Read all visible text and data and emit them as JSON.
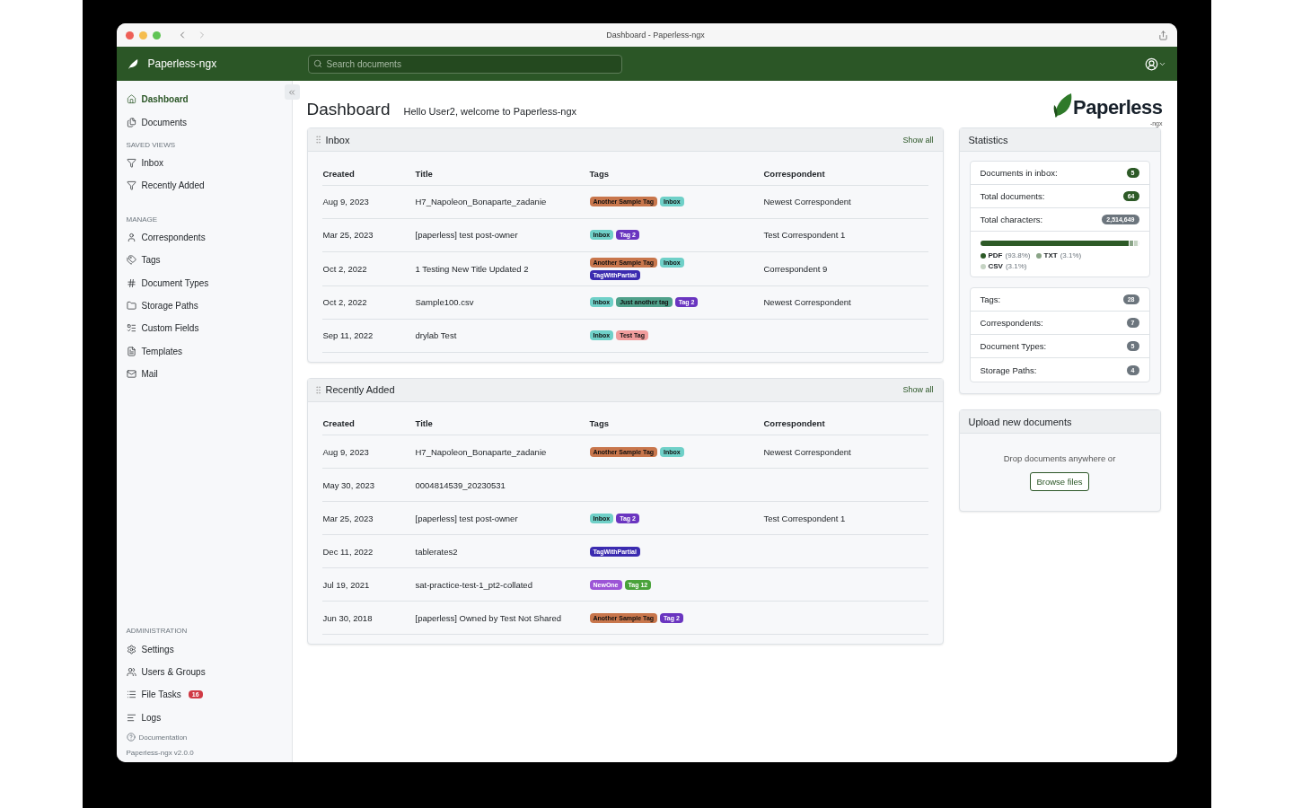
{
  "window": {
    "title": "Dashboard - Paperless-ngx"
  },
  "navbar": {
    "brand": "Paperless-ngx",
    "search": {
      "placeholder": "Search documents"
    }
  },
  "sidebar": {
    "items": [
      {
        "label": "Dashboard",
        "selected": true
      },
      {
        "label": "Documents",
        "selected": false
      }
    ],
    "sections": [
      {
        "heading": "SAVED VIEWS",
        "items": [
          {
            "label": "Inbox",
            "selected": false
          },
          {
            "label": "Recently Added",
            "selected": false
          }
        ]
      },
      {
        "heading": "MANAGE",
        "items": [
          {
            "label": "Correspondents",
            "selected": false
          },
          {
            "label": "Tags",
            "selected": false
          },
          {
            "label": "Document Types",
            "selected": false
          },
          {
            "label": "Storage Paths",
            "selected": false
          },
          {
            "label": "Custom Fields",
            "selected": false
          },
          {
            "label": "Templates",
            "selected": false
          },
          {
            "label": "Mail",
            "selected": false
          }
        ]
      },
      {
        "heading": "ADMINISTRATION",
        "items": [
          {
            "label": "Settings",
            "selected": false
          },
          {
            "label": "Users & Groups",
            "selected": false
          },
          {
            "label": "File Tasks",
            "selected": false,
            "badge": "16"
          },
          {
            "label": "Logs",
            "selected": false
          }
        ]
      }
    ],
    "documentation": "Documentation",
    "version": "Paperless-ngx v2.0.0"
  },
  "page": {
    "title": "Dashboard",
    "greeting": "Hello User2, welcome to Paperless-ngx",
    "logo": {
      "name": "Paperless",
      "suffix": "-ngx"
    }
  },
  "widgets": [
    {
      "title": "Inbox",
      "link": "Show all",
      "columns": [
        "Created",
        "Title",
        "Tags",
        "Correspondent"
      ],
      "rows": [
        {
          "created": "Aug 9, 2023",
          "title": "H7_Napoleon_Bonaparte_zadanie",
          "tags": [
            {
              "name": "Another Sample Tag",
              "color": "#c8764c"
            },
            {
              "name": "Inbox",
              "color": "#6fd0c8"
            }
          ],
          "correspondent": "Newest Correspondent"
        },
        {
          "created": "Mar 25, 2023",
          "title": "[paperless] test post-owner",
          "tags": [
            {
              "name": "Inbox",
              "color": "#6fd0c8"
            },
            {
              "name": "Tag 2",
              "color": "#6a35c0"
            }
          ],
          "correspondent": "Test Correspondent 1"
        },
        {
          "created": "Oct 2, 2022",
          "title": "1 Testing New Title Updated 2",
          "tags": [
            {
              "name": "Another Sample Tag",
              "color": "#c8764c"
            },
            {
              "name": "Inbox",
              "color": "#6fd0c8"
            },
            {
              "name": "TagWithPartial",
              "color": "#3b2bb0"
            }
          ],
          "correspondent": "Correspondent 9"
        },
        {
          "created": "Oct 2, 2022",
          "title": "Sample100.csv",
          "tags": [
            {
              "name": "Inbox",
              "color": "#6fd0c8"
            },
            {
              "name": "Just another tag",
              "color": "#4fa08a"
            },
            {
              "name": "Tag 2",
              "color": "#6a35c0"
            }
          ],
          "correspondent": "Newest Correspondent"
        },
        {
          "created": "Sep 11, 2022",
          "title": "drylab Test",
          "tags": [
            {
              "name": "Inbox",
              "color": "#6fd0c8"
            },
            {
              "name": "Test Tag",
              "color": "#f09c9c"
            }
          ]
        }
      ]
    },
    {
      "title": "Recently Added",
      "link": "Show all",
      "columns": [
        "Created",
        "Title",
        "Tags",
        "Correspondent"
      ],
      "rows": [
        {
          "created": "Aug 9, 2023",
          "title": "H7_Napoleon_Bonaparte_zadanie",
          "tags": [
            {
              "name": "Another Sample Tag",
              "color": "#c8764c"
            },
            {
              "name": "Inbox",
              "color": "#6fd0c8"
            }
          ],
          "correspondent": "Newest Correspondent"
        },
        {
          "created": "May 30, 2023",
          "title": "0004814539_20230531"
        },
        {
          "created": "Mar 25, 2023",
          "title": "[paperless] test post-owner",
          "tags": [
            {
              "name": "Inbox",
              "color": "#6fd0c8"
            },
            {
              "name": "Tag 2",
              "color": "#6a35c0"
            }
          ],
          "correspondent": "Test Correspondent 1"
        },
        {
          "created": "Dec 11, 2022",
          "title": "tablerates2",
          "tags": [
            {
              "name": "TagWithPartial",
              "color": "#3b2bb0"
            }
          ]
        },
        {
          "created": "Jul 19, 2021",
          "title": "sat-practice-test-1_pt2-collated",
          "tags": [
            {
              "name": "NewOne",
              "color": "#9c55d6"
            },
            {
              "name": "Tag 12",
              "color": "#4aa23a"
            }
          ]
        },
        {
          "created": "Jun 30, 2018",
          "title": "[paperless] Owned by Test Not Shared",
          "tags": [
            {
              "name": "Another Sample Tag",
              "color": "#c8764c"
            },
            {
              "name": "Tag 2",
              "color": "#6a35c0"
            }
          ]
        }
      ]
    }
  ],
  "statistics": {
    "title": "Statistics",
    "counts": [
      {
        "label": "Documents in inbox:",
        "value": "5",
        "color": "#2d5a27"
      },
      {
        "label": "Total documents:",
        "value": "64",
        "color": "#2d5a27"
      },
      {
        "label": "Total characters:",
        "value": "2,514,649",
        "color": "#6c757d"
      }
    ],
    "file_types": [
      {
        "name": "PDF",
        "share": "(93.8%)",
        "level": 0.938,
        "color": "#2d5a27"
      },
      {
        "name": "TXT",
        "share": "(3.1%)",
        "level": 0.031,
        "color": "#8aa487"
      },
      {
        "name": "CSV",
        "share": "(3.1%)",
        "level": 0.031,
        "color": "#c5d3c3"
      }
    ],
    "totals": [
      {
        "label": "Tags:",
        "value": "28"
      },
      {
        "label": "Correspondents:",
        "value": "7"
      },
      {
        "label": "Document Types:",
        "value": "5"
      },
      {
        "label": "Storage Paths:",
        "value": "4"
      }
    ]
  },
  "upload": {
    "title": "Upload new documents",
    "hint": "Drop documents anywhere or",
    "button": "Browse files"
  }
}
